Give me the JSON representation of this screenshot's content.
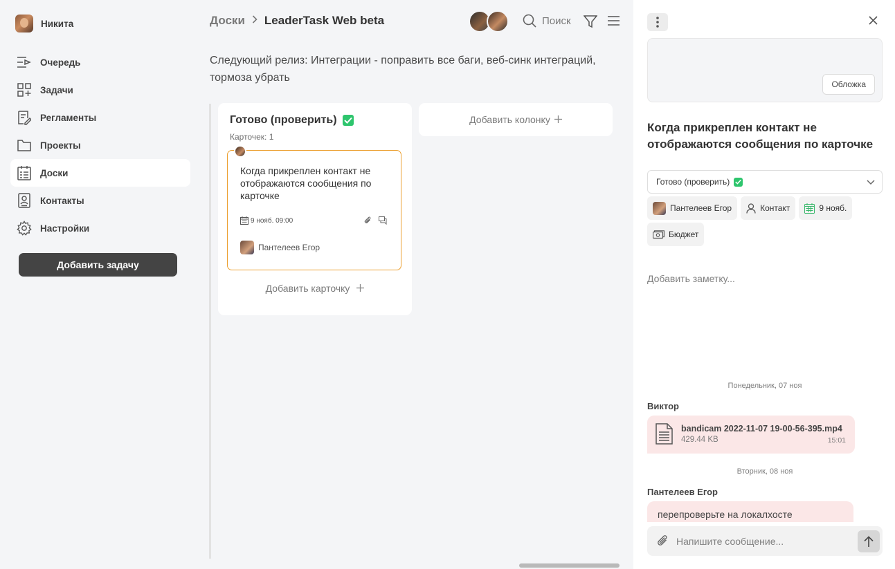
{
  "user": {
    "name": "Никита"
  },
  "sidebar": {
    "items": [
      {
        "label": "Очередь",
        "icon": "queue-icon"
      },
      {
        "label": "Задачи",
        "icon": "tasks-grid-icon"
      },
      {
        "label": "Регламенты",
        "icon": "regulations-icon"
      },
      {
        "label": "Проекты",
        "icon": "folder-icon"
      },
      {
        "label": "Доски",
        "icon": "board-icon",
        "active": true
      },
      {
        "label": "Контакты",
        "icon": "contacts-icon"
      },
      {
        "label": "Настройки",
        "icon": "gear-icon"
      }
    ],
    "add_task_label": "Добавить задачу"
  },
  "header": {
    "breadcrumb_root": "Доски",
    "breadcrumb_current": "LeaderTask Web beta",
    "search_label": "Поиск"
  },
  "board": {
    "release_text": "Следующий релиз: Интеграции - поправить все баги, веб-синк интеграций, тормоза убрать",
    "column": {
      "title": "Готово (проверить)",
      "count_label": "Карточек: 1",
      "add_card_label": "Добавить карточку",
      "card": {
        "title": "Когда прикреплен контакт не отображаются сообщения по карточке",
        "date": "9 нояб. 09:00",
        "assignee": "Пантелеев Егор"
      }
    },
    "add_column_label": "Добавить колонку"
  },
  "panel": {
    "cover_button": "Обложка",
    "task_title": "Когда прикреплен контакт не отображаются сообщения по карточке",
    "status": "Готово (проверить)",
    "chips": {
      "assignee": "Пантелеев Егор",
      "contact": "Контакт",
      "date": "9 нояб.",
      "budget": "Бюджет"
    },
    "note_placeholder": "Добавить заметку...",
    "chat": {
      "day1": "Понедельник, 07 ноя",
      "sender1": "Виктор",
      "file_name": "bandicam 2022-11-07 19-00-56-395.mp4",
      "file_size": "429.44 KB",
      "file_time": "15:01",
      "day2": "Вторник, 08 ноя",
      "sender2": "Пантелеев Егор",
      "message2": "перепроверьте на локалхосте"
    },
    "composer_placeholder": "Напишите сообщение..."
  },
  "colors": {
    "accent_card_border": "#ec9f2e",
    "status_green": "#2ec56d",
    "message_bubble": "#fbe7e7",
    "primary_button": "#444444"
  }
}
